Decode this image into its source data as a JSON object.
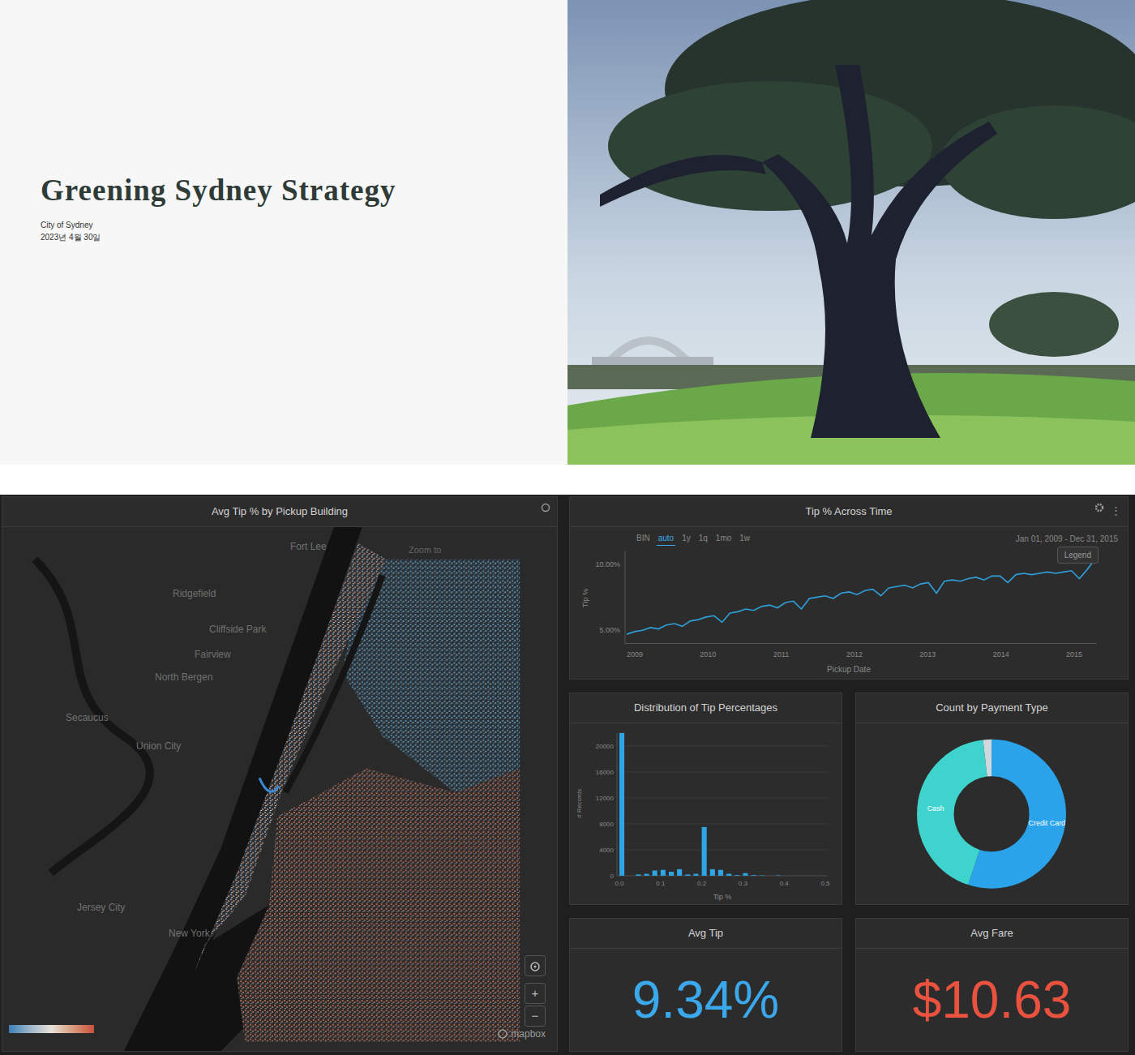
{
  "slide": {
    "title": "Greening Sydney Strategy",
    "subtitle": "City of Sydney",
    "date": "2023년 4월 30일"
  },
  "map": {
    "title": "Avg Tip % by Pickup Building",
    "zoom_label": "Zoom to",
    "labels": [
      "Fort Lee",
      "Ridgefield",
      "Cliffside Park",
      "Fairview",
      "North Bergen",
      "Secaucus",
      "Union City",
      "Jersey City",
      "New York"
    ],
    "zoom_in": "+",
    "zoom_out": "−",
    "attribution": "mapbox"
  },
  "tip_time": {
    "title": "Tip % Across Time",
    "menu": "⋮",
    "bin_label": "BIN",
    "bins": [
      {
        "label": "auto",
        "selected": true
      },
      {
        "label": "1y",
        "selected": false
      },
      {
        "label": "1q",
        "selected": false
      },
      {
        "label": "1mo",
        "selected": false
      },
      {
        "label": "1w",
        "selected": false
      }
    ],
    "range": "Jan 01, 2009 - Dec 31, 2015",
    "legend": "Legend",
    "y_title": "Tip %",
    "y_ticks": [
      {
        "label": "10.00%",
        "value": 10
      },
      {
        "label": "5.00%",
        "value": 5
      }
    ],
    "x_title": "Pickup Date",
    "x_ticks": [
      "2009",
      "2010",
      "2011",
      "2012",
      "2013",
      "2014",
      "2015"
    ],
    "series": [
      4.7,
      4.9,
      5.0,
      5.2,
      5.1,
      5.4,
      5.5,
      5.3,
      5.7,
      5.8,
      6.0,
      6.1,
      5.6,
      6.3,
      6.4,
      6.6,
      6.5,
      6.8,
      6.9,
      6.7,
      7.1,
      7.2,
      6.6,
      7.4,
      7.5,
      7.6,
      7.4,
      7.8,
      7.9,
      7.7,
      8.0,
      8.1,
      7.6,
      8.2,
      8.3,
      8.4,
      8.2,
      8.5,
      8.6,
      7.8,
      8.7,
      8.8,
      8.7,
      8.9,
      9.0,
      8.8,
      9.1,
      9.1,
      8.6,
      9.2,
      9.3,
      9.2,
      9.3,
      9.4,
      9.3,
      9.4,
      9.5,
      8.9,
      9.6,
      10.4
    ]
  },
  "tip_dist": {
    "title": "Distribution of Tip Percentages",
    "y_title": "# Records",
    "y_ticks": [
      "0",
      "4000",
      "8000",
      "12000",
      "16000",
      "20000"
    ],
    "x_title": "Tip %",
    "x_ticks": [
      "0.0",
      "0.1",
      "0.2",
      "0.3",
      "0.4",
      "0.5"
    ],
    "bars": [
      22000,
      0,
      200,
      300,
      800,
      900,
      600,
      1000,
      200,
      300,
      7500,
      1000,
      900,
      300,
      100,
      400,
      100,
      50,
      0,
      50,
      0,
      0,
      0,
      0,
      0
    ]
  },
  "payment": {
    "title": "Count by Payment Type",
    "slices": [
      {
        "label": "Credit Card",
        "value": 55,
        "color": "#2ba3ea"
      },
      {
        "label": "Cash",
        "value": 43,
        "color": "#3fd3cd"
      },
      {
        "value": 2,
        "color": "#cfd8dc"
      }
    ]
  },
  "stats": [
    {
      "label": "Avg Tip",
      "value": "9.34%",
      "color": "#3aa8ea"
    },
    {
      "label": "Avg Fare",
      "value": "$10.63",
      "color": "#e9523f"
    }
  ]
}
